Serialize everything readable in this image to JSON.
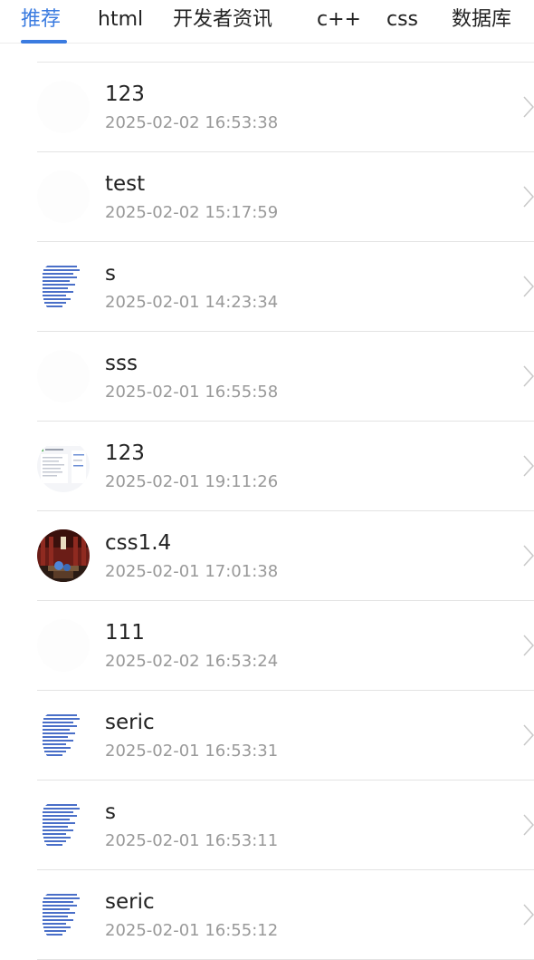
{
  "accent_color": "#3a7be0",
  "tabs": [
    {
      "label": "推荐",
      "active": true
    },
    {
      "label": "html",
      "active": false
    },
    {
      "label": "开发者资讯",
      "active": false
    },
    {
      "label": "c++",
      "active": false
    },
    {
      "label": "css",
      "active": false
    },
    {
      "label": "数据库",
      "active": false
    }
  ],
  "list": {
    "items": [
      {
        "title": "123",
        "time": "2025-02-02 16:53:38",
        "thumb": "blank-thumbnail"
      },
      {
        "title": "test",
        "time": "2025-02-02 15:17:59",
        "thumb": "blank-thumbnail"
      },
      {
        "title": "s",
        "time": "2025-02-01 14:23:34",
        "thumb": "text-document-thumbnail"
      },
      {
        "title": "sss",
        "time": "2025-02-01 16:55:58",
        "thumb": "blank-thumbnail"
      },
      {
        "title": "123",
        "time": "2025-02-01 19:11:26",
        "thumb": "webpage-screenshot-thumbnail"
      },
      {
        "title": "css1.4",
        "time": "2025-02-01 17:01:38",
        "thumb": "photo-thumbnail"
      },
      {
        "title": "111",
        "time": "2025-02-02 16:53:24",
        "thumb": "blank-thumbnail"
      },
      {
        "title": "seric",
        "time": "2025-02-01 16:53:31",
        "thumb": "text-document-thumbnail"
      },
      {
        "title": "s",
        "time": "2025-02-01 16:53:11",
        "thumb": "text-document-thumbnail"
      },
      {
        "title": "seric",
        "time": "2025-02-01 16:55:12",
        "thumb": "text-document-thumbnail"
      }
    ]
  }
}
